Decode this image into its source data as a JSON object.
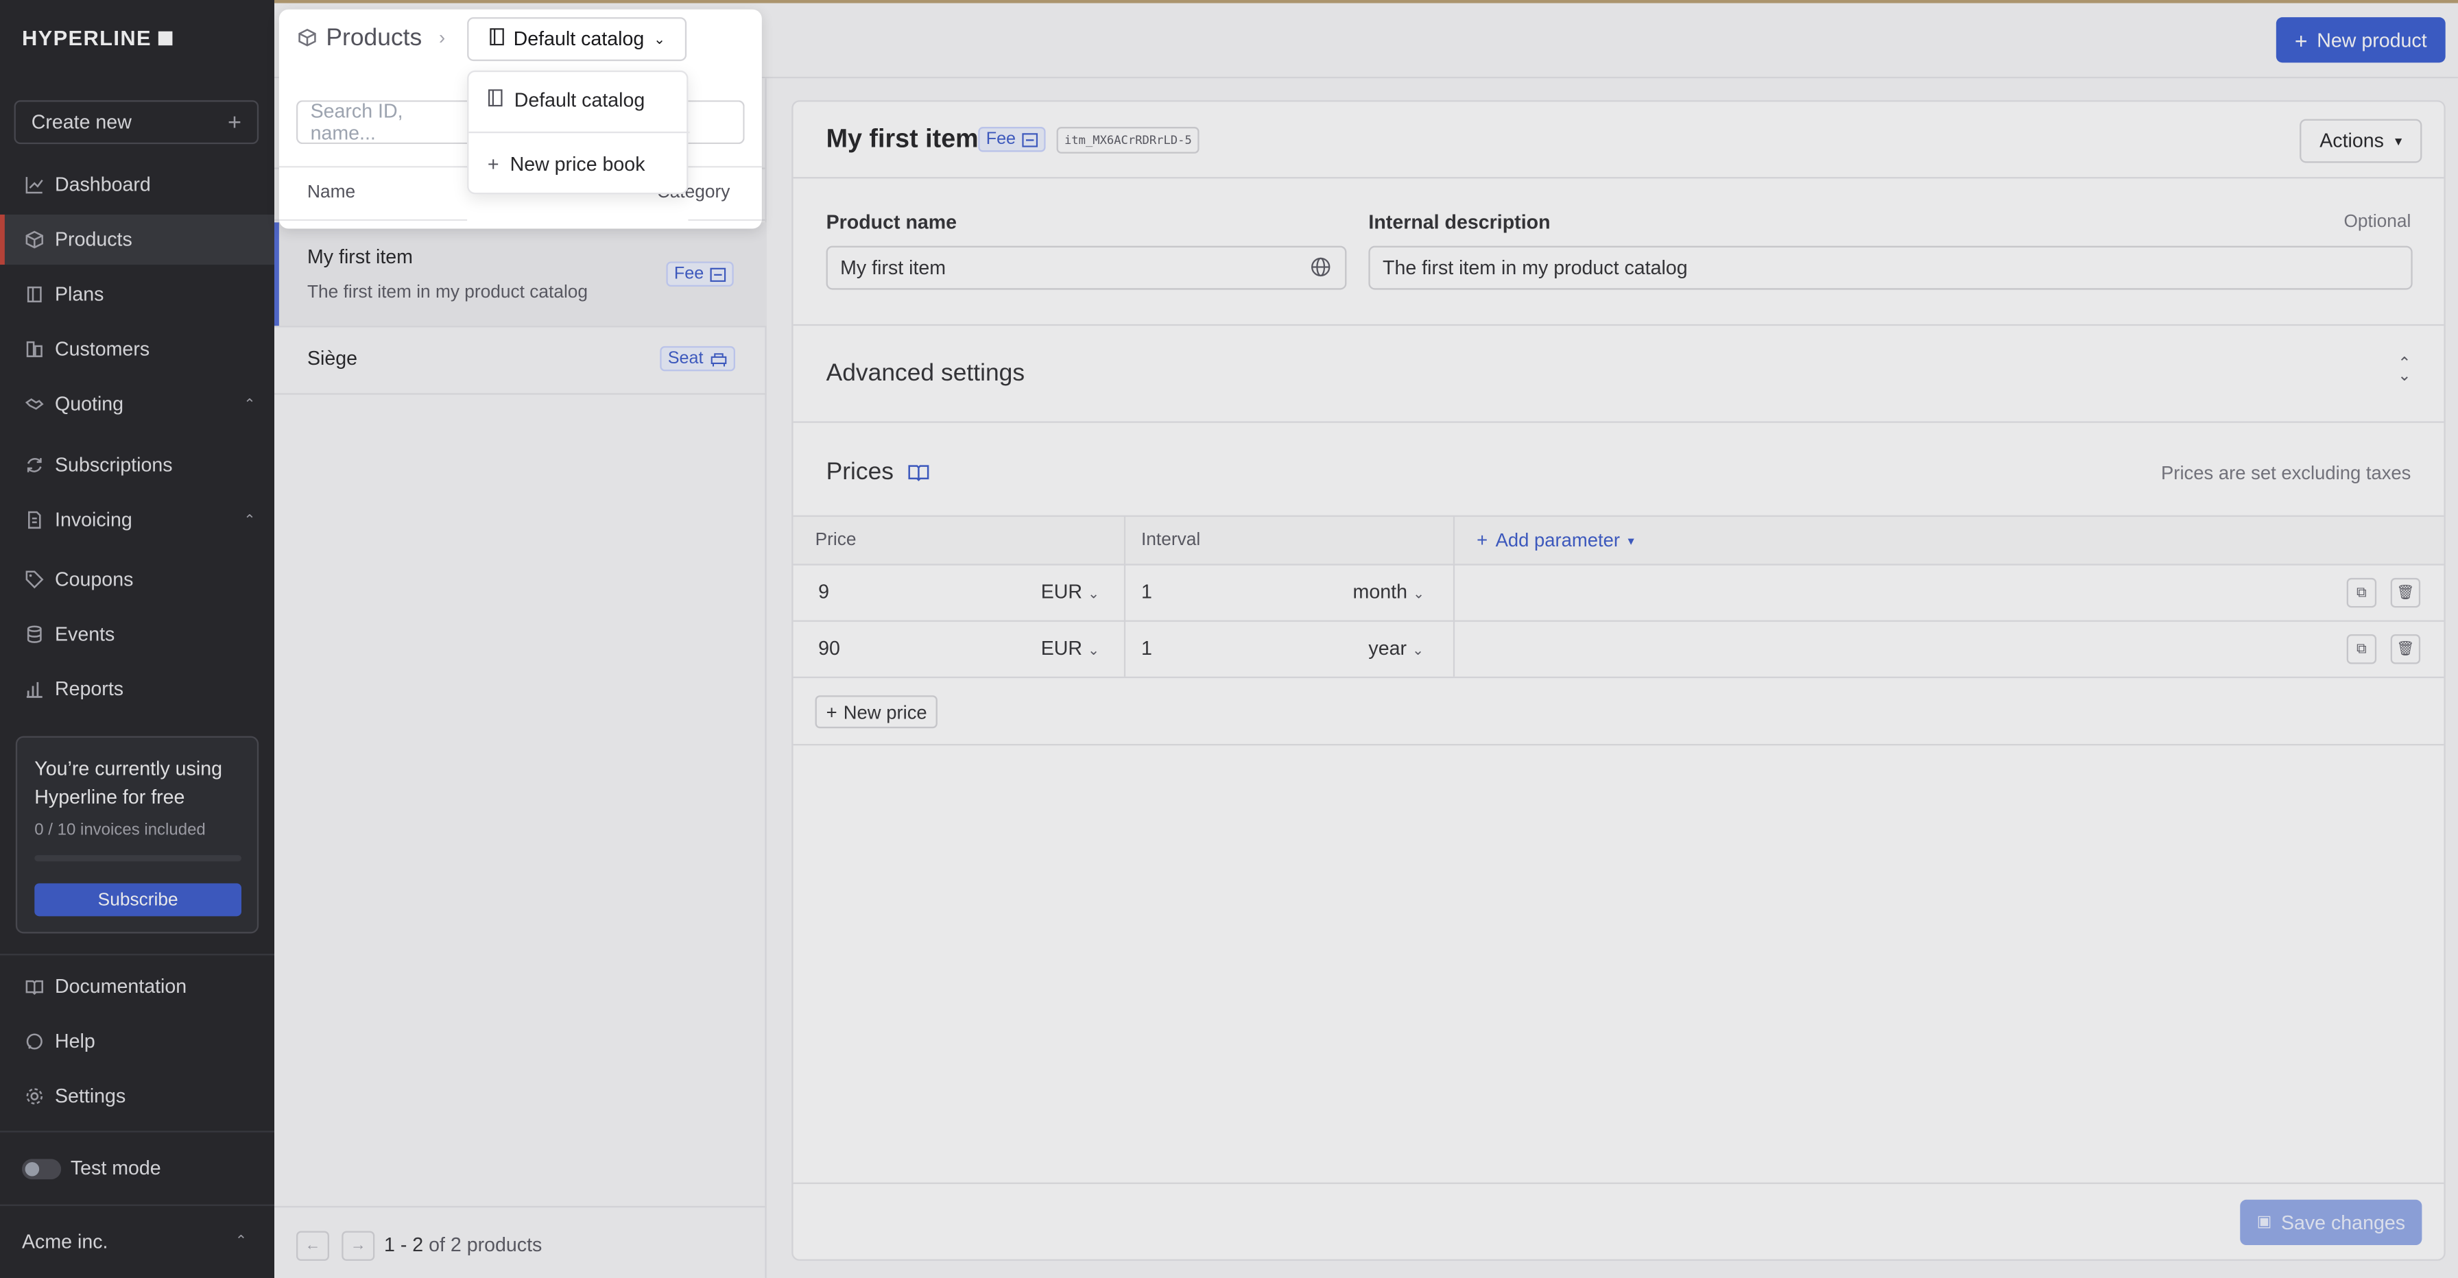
{
  "brand": {
    "logo_text": "HYPERLINE"
  },
  "sidebar": {
    "create_new": "Create new",
    "items": [
      {
        "label": "Dashboard",
        "icon": "chart-line-icon"
      },
      {
        "label": "Products",
        "icon": "box-icon",
        "active": true
      },
      {
        "label": "Plans",
        "icon": "book-icon"
      },
      {
        "label": "Customers",
        "icon": "building-icon"
      },
      {
        "label": "Quoting",
        "icon": "handshake-icon",
        "expandable": true
      },
      {
        "label": "Subscriptions",
        "icon": "refresh-icon"
      },
      {
        "label": "Invoicing",
        "icon": "file-icon",
        "expandable": true
      },
      {
        "label": "Coupons",
        "icon": "tag-icon"
      },
      {
        "label": "Events",
        "icon": "database-icon"
      },
      {
        "label": "Reports",
        "icon": "bar-chart-icon"
      }
    ],
    "free_card": {
      "title": "You’re currently using Hyperline for free",
      "usage": "0 / 10 invoices included",
      "usage_fraction": 0,
      "button": "Subscribe"
    },
    "bottom_items": [
      {
        "label": "Documentation",
        "icon": "book-open-icon"
      },
      {
        "label": "Help",
        "icon": "chat-icon"
      },
      {
        "label": "Settings",
        "icon": "gear-icon"
      }
    ],
    "test_mode": {
      "label": "Test mode",
      "enabled": false
    },
    "organization": "Acme inc."
  },
  "header": {
    "breadcrumb_root": "Products",
    "catalog_selected": "Default catalog",
    "new_product": "New product"
  },
  "catalog_menu": {
    "items": [
      "Default catalog"
    ],
    "new_price_book": "New price book"
  },
  "list": {
    "search_placeholder": "Search ID, name...",
    "col_name": "Name",
    "col_category": "Category",
    "rows": [
      {
        "name": "My first item",
        "description": "The first item in my product catalog",
        "category": "Fee"
      },
      {
        "name": "Siège",
        "description": "",
        "category": "Seat"
      }
    ],
    "pagination": {
      "range": "1 - 2",
      "of_text": "of 2 products"
    }
  },
  "detail": {
    "title": "My first item",
    "category": "Fee",
    "id": "itm_MX6ACrRDRrLD-5",
    "actions": "Actions",
    "product_name_label": "Product name",
    "product_name_value": "My first item",
    "internal_description_label": "Internal description",
    "optional": "Optional",
    "internal_description_value": "The first item in my product catalog",
    "advanced_settings": "Advanced settings",
    "prices_title": "Prices",
    "prices_note": "Prices are set excluding taxes",
    "table": {
      "col_price": "Price",
      "col_interval": "Interval",
      "add_parameter": "Add parameter",
      "rows": [
        {
          "price": "9",
          "currency": "EUR",
          "interval_count": "1",
          "interval_unit": "month"
        },
        {
          "price": "90",
          "currency": "EUR",
          "interval_count": "1",
          "interval_unit": "year"
        }
      ]
    },
    "new_price": "New price",
    "save_changes": "Save changes"
  },
  "colors": {
    "sidebar_bg": "#18191c",
    "primary": "#2f55cf",
    "active_marker": "#c0392b",
    "badge_text": "#3153c9"
  }
}
